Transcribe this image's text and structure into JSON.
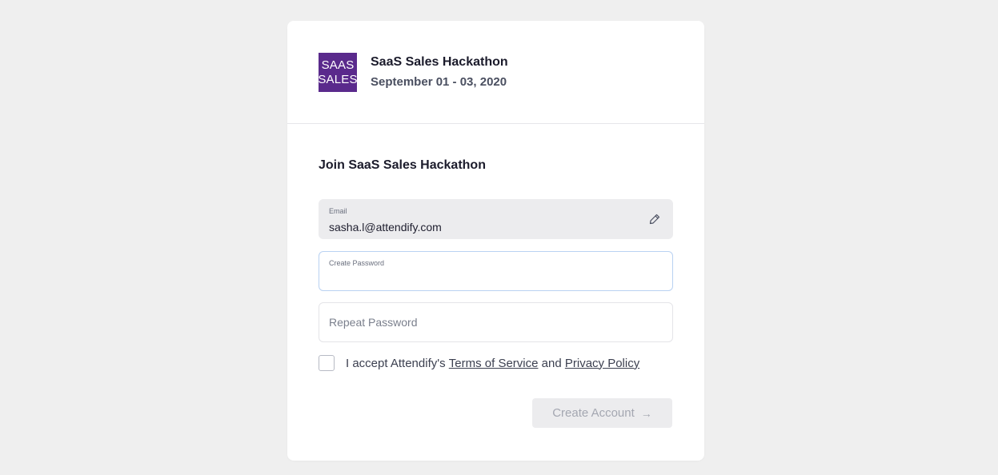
{
  "event": {
    "logo_line1": "SAAS",
    "logo_line2": "SALES",
    "title": "SaaS Sales Hackathon",
    "dates": "September 01 - 03, 2020"
  },
  "form": {
    "title": "Join SaaS Sales Hackathon",
    "email": {
      "label": "Email",
      "value": "sasha.l@attendify.com",
      "icon": "pencil-icon"
    },
    "create_password": {
      "label": "Create Password",
      "value": ""
    },
    "repeat_password": {
      "placeholder": "Repeat Password",
      "value": ""
    },
    "consent": {
      "prefix": "I accept Attendify's",
      "terms_link": "Terms of Service",
      "joiner": "and",
      "privacy_link": "Privacy Policy",
      "checked": false
    },
    "submit_label": "Create Account",
    "submit_arrow": "→"
  },
  "colors": {
    "logo_bg": "#5a2a8c",
    "page_bg": "#efefef",
    "focus_border": "#b9d2f2",
    "disabled_button_bg": "#ececee",
    "disabled_button_text": "#a4a7b1"
  }
}
